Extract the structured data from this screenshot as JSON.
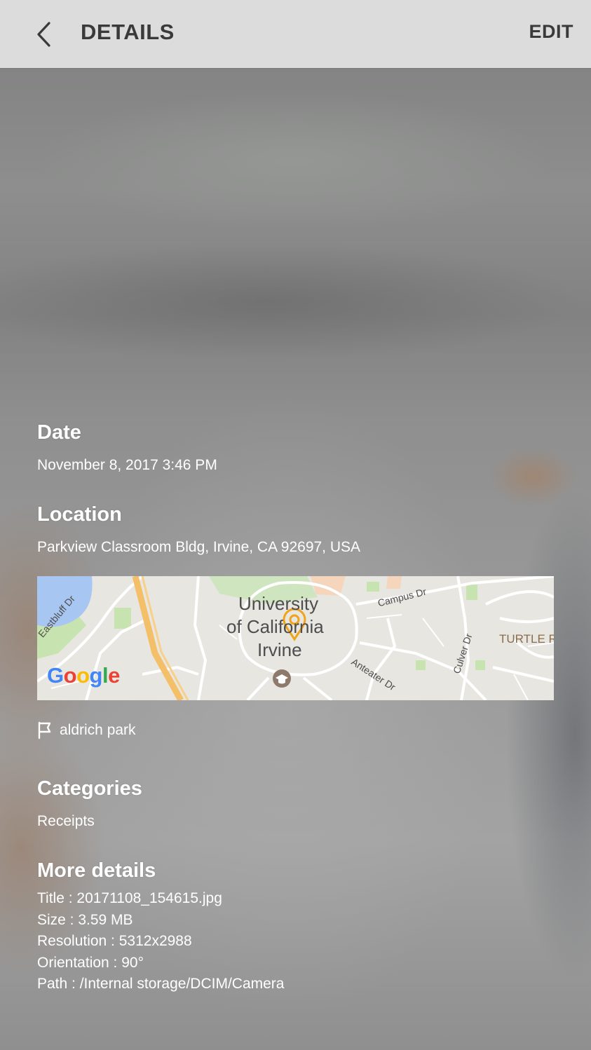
{
  "header": {
    "title": "DETAILS",
    "edit_label": "EDIT",
    "back_icon": "chevron-left-icon"
  },
  "date": {
    "heading": "Date",
    "value": "November 8, 2017 3:46 PM"
  },
  "location": {
    "heading": "Location",
    "address": "Parkview Classroom Bldg, Irvine, CA 92697, USA",
    "map": {
      "place_label_lines": [
        "University",
        "of California",
        "Irvine"
      ],
      "streets": [
        "Campus Dr",
        "Eastbluff Dr",
        "Anteater Dr",
        "Culver Dr"
      ],
      "area_label": "TURTLE R",
      "provider": "Google"
    },
    "tag": {
      "icon": "tag-flag-icon",
      "label": "aldrich park"
    }
  },
  "categories": {
    "heading": "Categories",
    "value": "Receipts"
  },
  "more_details": {
    "heading": "More details",
    "lines": [
      "Title : 20171108_154615.jpg",
      "Size : 3.59 MB",
      "Resolution : 5312x2988",
      "Orientation : 90°",
      "Path : /Internal storage/DCIM/Camera"
    ]
  },
  "colors": {
    "header_bg": "#dcdcdc",
    "header_text": "#3a3a3a",
    "content_text": "#ffffff",
    "map_pin": "#f0a419",
    "google_blue": "#4285F4",
    "google_red": "#EA4335",
    "google_yellow": "#FBBC05",
    "google_green": "#34A853"
  }
}
